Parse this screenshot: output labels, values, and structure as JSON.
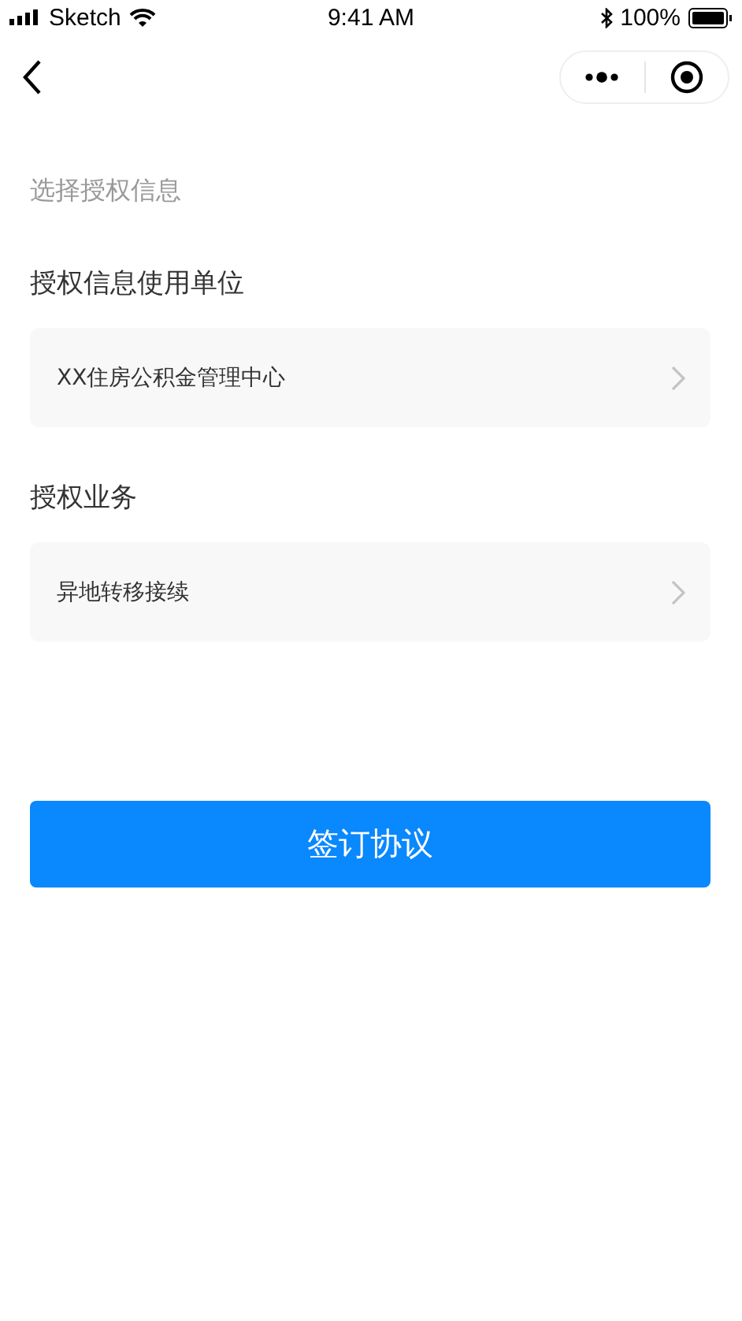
{
  "status_bar": {
    "carrier": "Sketch",
    "time": "9:41 AM",
    "battery": "100%"
  },
  "section_title": "选择授权信息",
  "fields": [
    {
      "label": "授权信息使用单位",
      "value": "XX住房公积金管理中心"
    },
    {
      "label": "授权业务",
      "value": "异地转移接续"
    }
  ],
  "submit_button": "签订协议"
}
